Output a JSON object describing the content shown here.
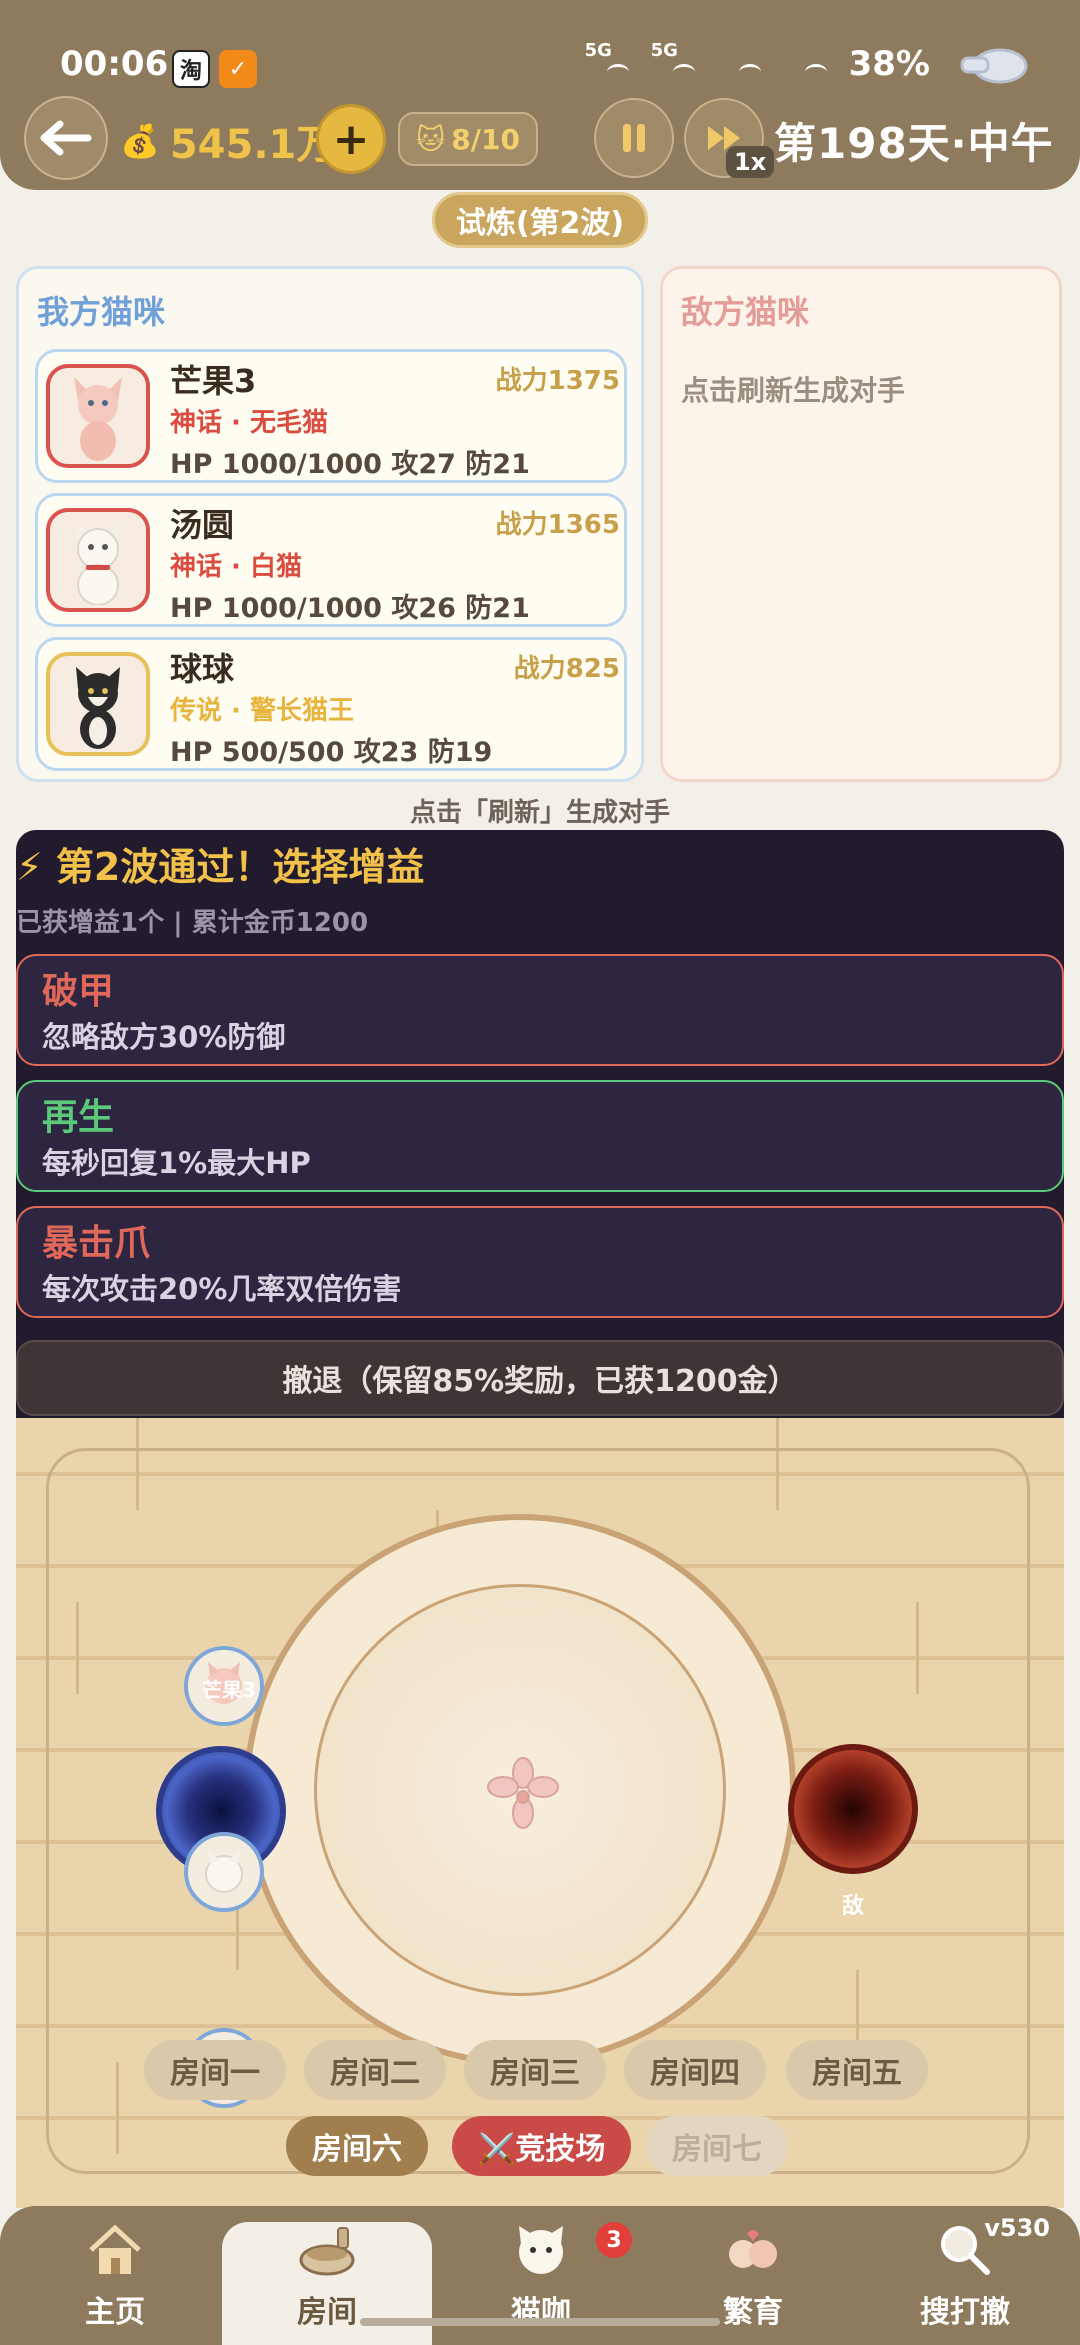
{
  "status": {
    "time": "00:06",
    "app_icon_1": "淘",
    "app_icon_2": "✓",
    "net_1": "5G",
    "net_2": "5G",
    "battery": "38%"
  },
  "header": {
    "money": "545.1万",
    "cat_count": "8/10",
    "speed": "1x",
    "day": "第198天·中午"
  },
  "trial_label": "试炼(第2波)",
  "my_panel": {
    "title": "我方猫咪",
    "cats": [
      {
        "name": "芒果3",
        "power": "战力1375",
        "rarity": "神话 · 无毛猫",
        "stats": "HP 1000/1000  攻27 防21",
        "tier": "mythic"
      },
      {
        "name": "汤圆",
        "power": "战力1365",
        "rarity": "神话 · 白猫",
        "stats": "HP 1000/1000  攻26 防21",
        "tier": "mythic"
      },
      {
        "name": "球球",
        "power": "战力825",
        "rarity": "传说 · 警长猫王",
        "stats": "HP 500/500  攻23 防19",
        "tier": "legend"
      }
    ]
  },
  "enemy_panel": {
    "title": "敌方猫咪",
    "hint": "点击刷新生成对手"
  },
  "refresh_hint": "点击「刷新」生成对手",
  "buff_section": {
    "title": "⚡ 第2波通过！选择增益",
    "subtitle": "已获增益1个 | 累计金币1200",
    "buffs": [
      {
        "name": "破甲",
        "desc": "忽略敌方30%防御",
        "color": "#e0685a"
      },
      {
        "name": "再生",
        "desc": "每秒回复1%最大HP",
        "color": "#5cc97a"
      },
      {
        "name": "暴击爪",
        "desc": "每次攻击20%几率双倍伤害",
        "color": "#e0685a"
      }
    ],
    "retreat": "撤退（保留85%奖励，已获1200金）"
  },
  "arena": {
    "token_top_label": "芒果3",
    "enemy_label": "敌",
    "rooms": [
      "房间一",
      "房间二",
      "房间三",
      "房间四",
      "房间五"
    ],
    "rooms_row2": [
      "房间六",
      "⚔️竞技场",
      "房间七"
    ]
  },
  "bottom_nav": {
    "items": [
      "主页",
      "房间",
      "猫咖",
      "繁育",
      "搜打撤"
    ],
    "badge": "3",
    "version": "v530"
  },
  "colors": {
    "bar": "#8e7a5c",
    "gold": "#efc34a",
    "mythic": "#d94c3f",
    "legend": "#e7b53e",
    "buff_bg": "#221b2d"
  }
}
